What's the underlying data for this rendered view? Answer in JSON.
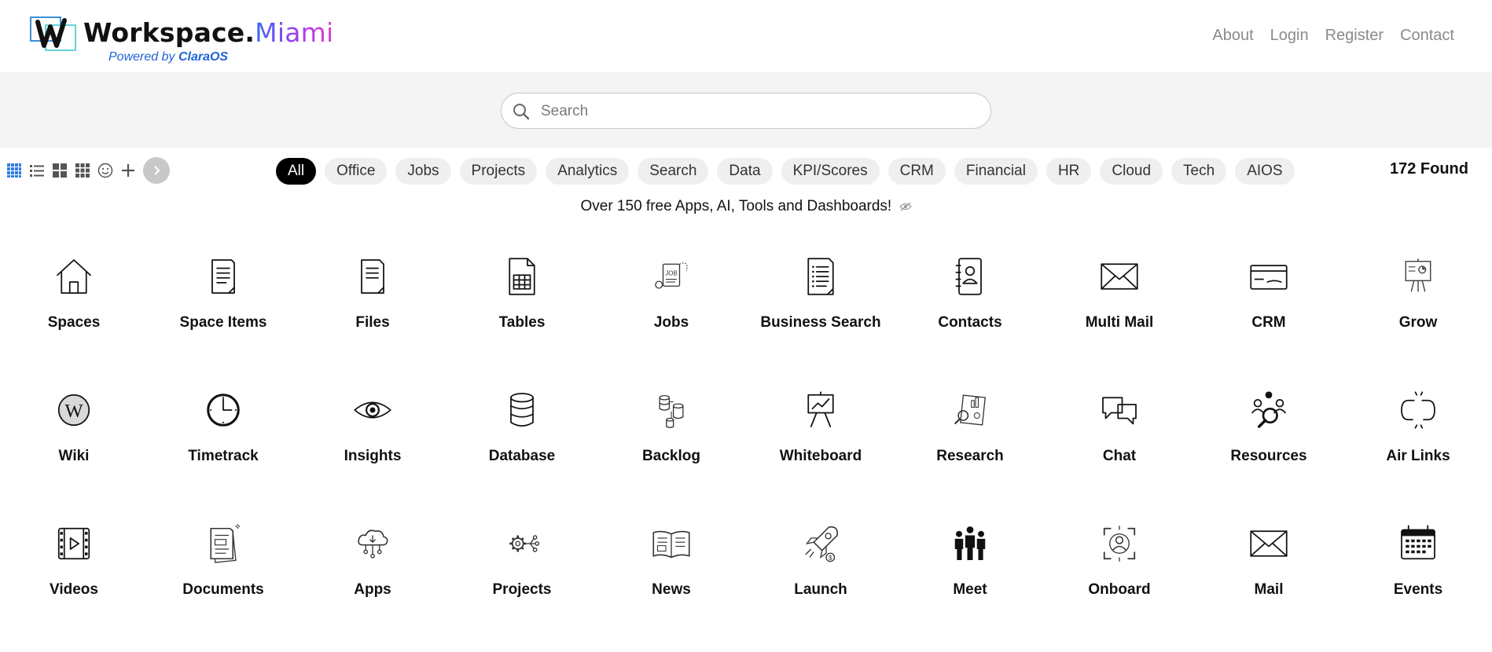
{
  "brand": {
    "name": "Workspace",
    "dot": ".",
    "city": "Miami",
    "powered_prefix": "Powered by",
    "powered_name": "ClaraOS"
  },
  "nav": [
    "About",
    "Login",
    "Register",
    "Contact"
  ],
  "search": {
    "placeholder": "Search",
    "value": ""
  },
  "toolbar_icons": [
    "grid-small-icon",
    "list-icon",
    "grid-large-icon",
    "grid-medium-icon",
    "smiley-icon",
    "plus-icon",
    "chevron-right-icon"
  ],
  "filters": [
    "All",
    "Office",
    "Jobs",
    "Projects",
    "Analytics",
    "Search",
    "Data",
    "KPI/Scores",
    "CRM",
    "Financial",
    "HR",
    "Cloud",
    "Tech",
    "AIOS"
  ],
  "active_filter": "All",
  "found_text": "172 Found",
  "tagline": "Over 150 free Apps, AI, Tools and Dashboards!",
  "apps": [
    {
      "label": "Spaces",
      "icon": "house-icon"
    },
    {
      "label": "Space Items",
      "icon": "document-icon"
    },
    {
      "label": "Files",
      "icon": "file-icon"
    },
    {
      "label": "Tables",
      "icon": "spreadsheet-icon"
    },
    {
      "label": "Jobs",
      "icon": "jobs-icon"
    },
    {
      "label": "Business Search",
      "icon": "list-document-icon"
    },
    {
      "label": "Contacts",
      "icon": "address-book-icon"
    },
    {
      "label": "Multi Mail",
      "icon": "envelope-icon"
    },
    {
      "label": "CRM",
      "icon": "card-icon"
    },
    {
      "label": "Grow",
      "icon": "presentation-icon"
    },
    {
      "label": "Wiki",
      "icon": "wikipedia-icon"
    },
    {
      "label": "Timetrack",
      "icon": "clock-icon"
    },
    {
      "label": "Insights",
      "icon": "eye-icon"
    },
    {
      "label": "Database",
      "icon": "database-icon"
    },
    {
      "label": "Backlog",
      "icon": "backlog-icon"
    },
    {
      "label": "Whiteboard",
      "icon": "whiteboard-icon"
    },
    {
      "label": "Research",
      "icon": "research-icon"
    },
    {
      "label": "Chat",
      "icon": "chat-bubbles-icon"
    },
    {
      "label": "Resources",
      "icon": "people-search-icon"
    },
    {
      "label": "Air Links",
      "icon": "broken-link-icon"
    },
    {
      "label": "Videos",
      "icon": "video-film-icon"
    },
    {
      "label": "Documents",
      "icon": "documents-icon"
    },
    {
      "label": "Apps",
      "icon": "cloud-network-icon"
    },
    {
      "label": "Projects",
      "icon": "gear-network-icon"
    },
    {
      "label": "News",
      "icon": "open-book-icon"
    },
    {
      "label": "Launch",
      "icon": "rocket-icon"
    },
    {
      "label": "Meet",
      "icon": "group-people-icon"
    },
    {
      "label": "Onboard",
      "icon": "user-focus-icon"
    },
    {
      "label": "Mail",
      "icon": "mail-icon"
    },
    {
      "label": "Events",
      "icon": "calendar-icon"
    }
  ]
}
